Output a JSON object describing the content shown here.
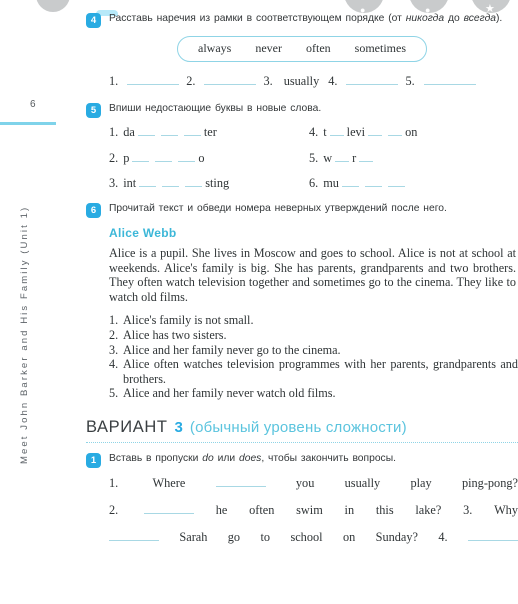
{
  "sidebar": {
    "page_number": "6",
    "running_title": "Meet John Barker and His Family (Unit 1)"
  },
  "decor": {
    "glyph1": "●",
    "glyph2": "●",
    "glyph3": "★"
  },
  "exercise4": {
    "number": "4",
    "instruction_part1": "Расставь наречия из рамки в соответствующем порядке (от ",
    "instruction_italic": "никогда",
    "instruction_part2": " до ",
    "instruction_italic2": "всегда",
    "instruction_part3": ").",
    "wordbank": [
      "always",
      "never",
      "often",
      "sometimes"
    ],
    "answers": [
      {
        "num": "1.",
        "value": ""
      },
      {
        "num": "2.",
        "value": ""
      },
      {
        "num": "3.",
        "value": "usually"
      },
      {
        "num": "4.",
        "value": ""
      },
      {
        "num": "5.",
        "value": ""
      }
    ]
  },
  "exercise5": {
    "number": "5",
    "instruction": "Впиши недостающие буквы в новые слова.",
    "items": [
      {
        "num": "1.",
        "prefix": "da",
        "blanks": 3,
        "suffix": "ter"
      },
      {
        "num": "4.",
        "prefix": "t",
        "blanks": 1,
        "mid": "levi",
        "blanks2": 2,
        "suffix": "on"
      },
      {
        "num": "2.",
        "prefix": "p",
        "blanks": 3,
        "suffix": "o"
      },
      {
        "num": "5.",
        "prefix": "w",
        "blanks": 1,
        "mid": "r",
        "blanks2": 1,
        "suffix": ""
      },
      {
        "num": "3.",
        "prefix": "int",
        "blanks": 3,
        "suffix": "sting"
      },
      {
        "num": "6.",
        "prefix": "mu",
        "blanks": 3,
        "suffix": ""
      }
    ]
  },
  "exercise6": {
    "number": "6",
    "instruction": "Прочитай текст и обведи номера неверных утверждений после него.",
    "text_title": "Alice Webb",
    "text_body": "Alice is a pupil. She lives in Moscow and goes to school. Alice is not at school at weekends. Alice's family is big. She has parents, grandparents and two brothers. They often watch television together and sometimes go to the cinema. They like to watch old films.",
    "statements": [
      {
        "num": "1.",
        "text": "Alice's family is not small."
      },
      {
        "num": "2.",
        "text": "Alice has two sisters."
      },
      {
        "num": "3.",
        "text": "Alice and her family never go to the cinema."
      },
      {
        "num": "4.",
        "text": "Alice often watches television programmes with her parents, grandparents and brothers."
      },
      {
        "num": "5.",
        "text": "Alice and her family never watch old films."
      }
    ]
  },
  "variant": {
    "word": "ВАРИАНТ",
    "number": "3",
    "subtitle": "(обычный уровень сложности)"
  },
  "exercise1": {
    "number": "1",
    "instruction_part1": "Вставь в пропуски ",
    "instruction_italic": "do",
    "instruction_part2": " или ",
    "instruction_italic2": "does",
    "instruction_part3": ", чтобы закончить вопросы.",
    "line1": {
      "num": "1.",
      "w1": "Where",
      "w2": "you",
      "w3": "usually",
      "w4": "play",
      "w5": "ping-pong?"
    },
    "line2": {
      "num": "2.",
      "w1": "he",
      "w2": "often",
      "w3": "swim",
      "w4": "in",
      "w5": "this",
      "w6": "lake?",
      "num2": "3.",
      "w7": "Why"
    },
    "line3": {
      "w1": "Sarah",
      "w2": "go",
      "w3": "to",
      "w4": "school",
      "w5": "on",
      "w6": "Sunday?",
      "num2": "4."
    }
  },
  "colors": {
    "accent": "#29abe2",
    "accent_light": "#8fd4e6",
    "title_teal": "#3cb7d8",
    "text": "#2f3436"
  }
}
